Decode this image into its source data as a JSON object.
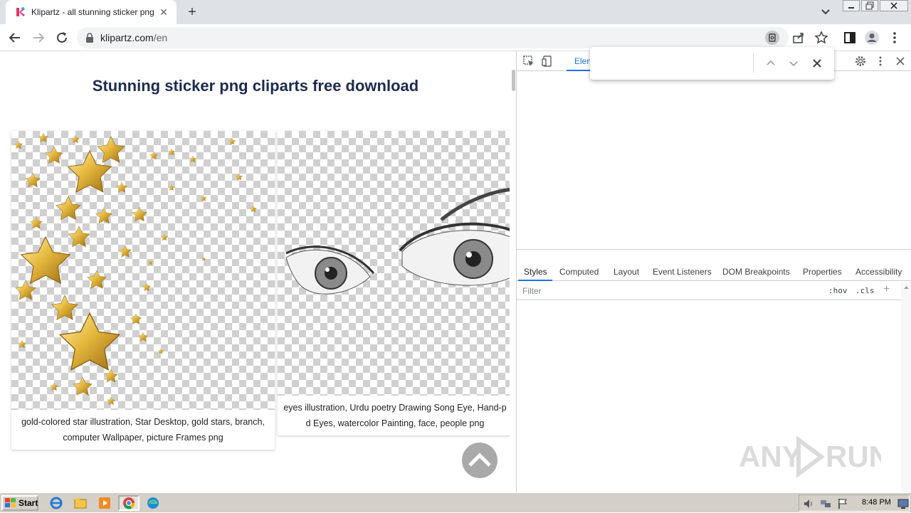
{
  "browser": {
    "tab_title": "Klipartz - all stunning sticker png ima",
    "url_host": "klipartz.com",
    "url_path": "/en"
  },
  "page": {
    "heading": "Stunning sticker png cliparts free download",
    "cards": [
      {
        "caption": "gold-colored star illustration, Star Desktop, gold stars, branch, computer Wallpaper, picture Frames png"
      },
      {
        "caption": "eyes illustration, Urdu poetry Drawing Song Eye, Hand-p d Eyes, watercolor Painting, face, people png"
      }
    ]
  },
  "devtools": {
    "elements_tab": "Elem",
    "subtabs": [
      "Styles",
      "Computed",
      "Layout",
      "Event Listeners",
      "DOM Breakpoints",
      "Properties",
      "Accessibility"
    ],
    "filter_placeholder": "Filter",
    "hov": ":hov",
    "cls": ".cls",
    "find_value": ""
  },
  "taskbar": {
    "start_label": "Start",
    "clock": "8:48 PM"
  },
  "colors": {
    "accent": "#1a73e8",
    "heading": "#1d2b4f",
    "taskbar": "#d4d0c8"
  }
}
